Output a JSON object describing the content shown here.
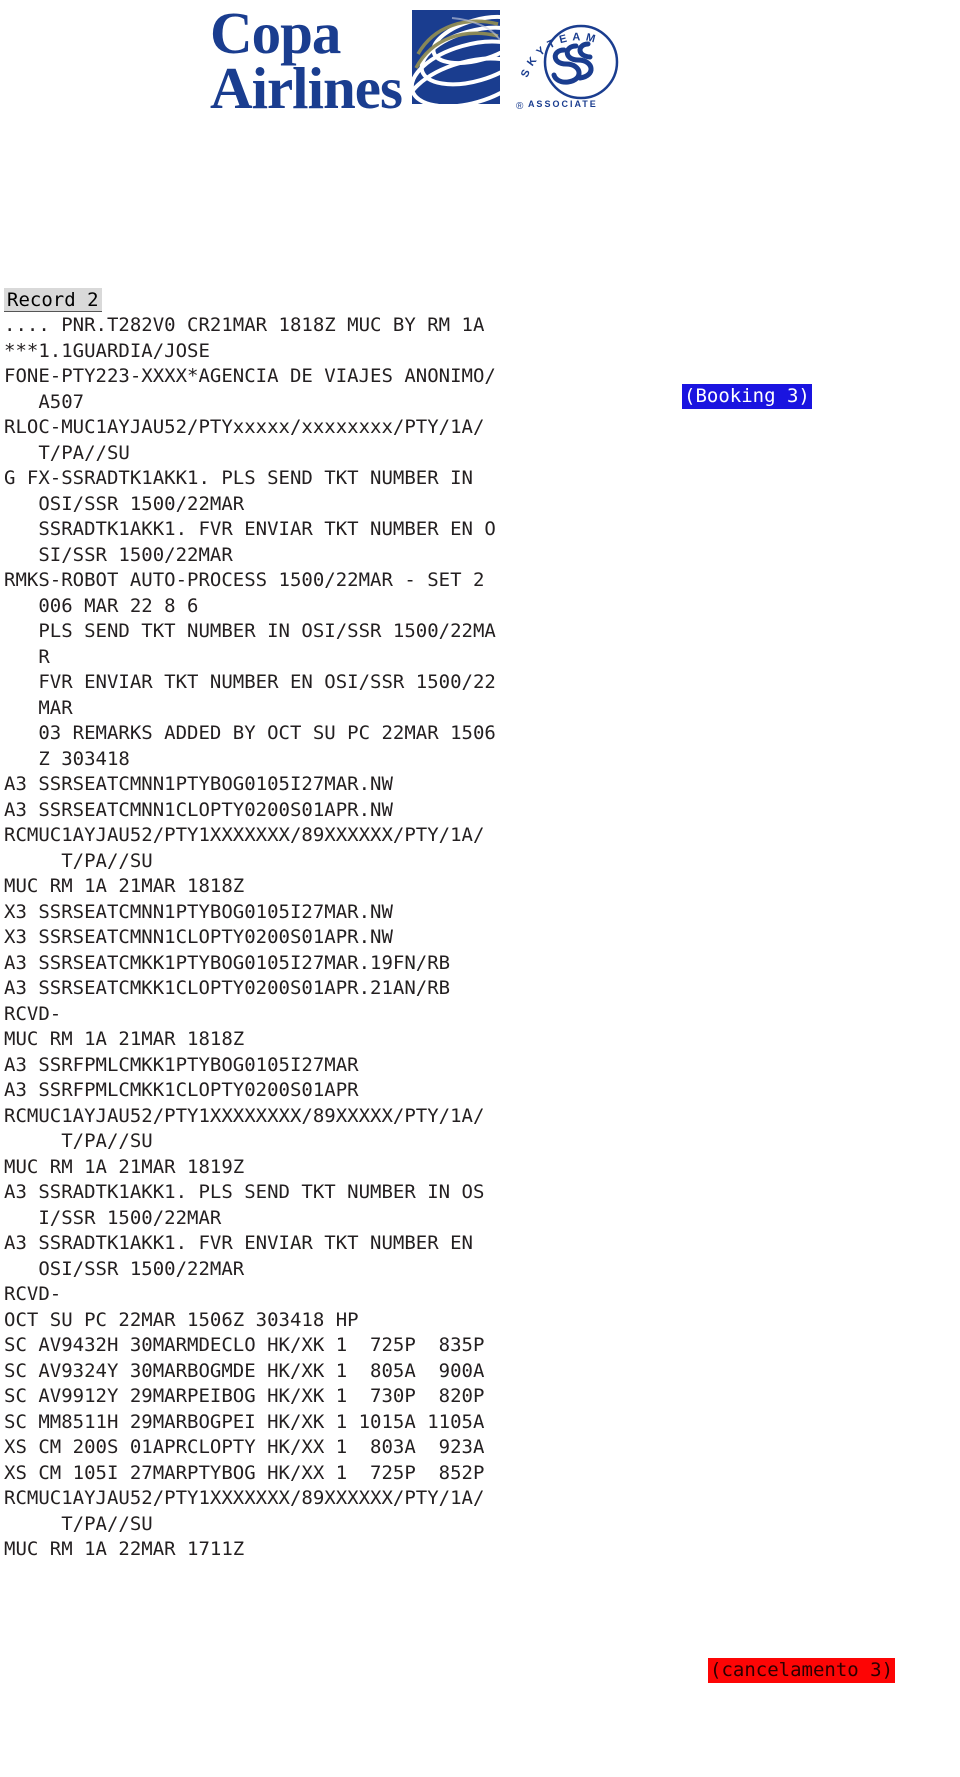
{
  "logo": {
    "brand_line1": "Copa",
    "brand_line2": "Airlines",
    "brand_color": "#1a3d8f",
    "alliance_name": "SKYTEAM",
    "alliance_tier": "ASSOCIATE",
    "registered_mark": "®"
  },
  "record": {
    "title": "Record 2"
  },
  "annotations": {
    "booking": {
      "label": "(Booking 3)",
      "bg_color": "#1a14e0",
      "text_color": "#ffffff"
    },
    "cancellation": {
      "label": "(cancelamento 3)",
      "bg_color": "#fd0505",
      "text_color": "#2b0000"
    }
  },
  "pnr": {
    "lines": [
      ".... PNR.T282V0 CR21MAR 1818Z MUC BY RM 1A",
      "***1.1GUARDIA/JOSE",
      "FONE-PTY223-XXXX*AGENCIA DE VIAJES ANONIMO/",
      "   A507",
      "RLOC-MUC1AYJAU52/PTYxxxxx/xxxxxxxx/PTY/1A/",
      "   T/PA//SU",
      "G FX-SSRADTK1AKK1. PLS SEND TKT NUMBER IN",
      "   OSI/SSR 1500/22MAR",
      "   SSRADTK1AKK1. FVR ENVIAR TKT NUMBER EN O",
      "   SI/SSR 1500/22MAR",
      "RMKS-ROBOT AUTO-PROCESS 1500/22MAR - SET 2",
      "   006 MAR 22 8 6",
      "   PLS SEND TKT NUMBER IN OSI/SSR 1500/22MA",
      "   R",
      "   FVR ENVIAR TKT NUMBER EN OSI/SSR 1500/22",
      "   MAR",
      "   03 REMARKS ADDED BY OCT SU PC 22MAR 1506",
      "   Z 303418",
      "A3 SSRSEATCMNN1PTYBOG0105I27MAR.NW",
      "A3 SSRSEATCMNN1CLOPTY0200S01APR.NW",
      "RCMUC1AYJAU52/PTY1XXXXXXX/89XXXXXX/PTY/1A/",
      "     T/PA//SU",
      "MUC RM 1A 21MAR 1818Z",
      "X3 SSRSEATCMNN1PTYBOG0105I27MAR.NW",
      "X3 SSRSEATCMNN1CLOPTY0200S01APR.NW",
      "A3 SSRSEATCMKK1PTYBOG0105I27MAR.19FN/RB",
      "A3 SSRSEATCMKK1CLOPTY0200S01APR.21AN/RB",
      "RCVD-",
      "MUC RM 1A 21MAR 1818Z",
      "A3 SSRFPMLCMKK1PTYBOG0105I27MAR",
      "A3 SSRFPMLCMKK1CLOPTY0200S01APR",
      "RCMUC1AYJAU52/PTY1XXXXXXXX/89XXXXX/PTY/1A/",
      "     T/PA//SU",
      "MUC RM 1A 21MAR 1819Z",
      "A3 SSRADTK1AKK1. PLS SEND TKT NUMBER IN OS",
      "   I/SSR 1500/22MAR",
      "A3 SSRADTK1AKK1. FVR ENVIAR TKT NUMBER EN",
      "   OSI/SSR 1500/22MAR",
      "RCVD-",
      "OCT SU PC 22MAR 1506Z 303418 HP",
      "SC AV9432H 30MARMDECLO HK/XK 1  725P  835P",
      "SC AV9324Y 30MARBOGMDE HK/XK 1  805A  900A",
      "SC AV9912Y 29MARPEIBOG HK/XK 1  730P  820P",
      "SC MM8511H 29MARBOGPEI HK/XK 1 1015A 1105A",
      "XS CM 200S 01APRCLOPTY HK/XX 1  803A  923A",
      "XS CM 105I 27MARPTYBOG HK/XX 1  725P  852P",
      "RCMUC1AYJAU52/PTY1XXXXXXX/89XXXXXX/PTY/1A/",
      "     T/PA//SU",
      "MUC RM 1A 22MAR 1711Z"
    ]
  }
}
